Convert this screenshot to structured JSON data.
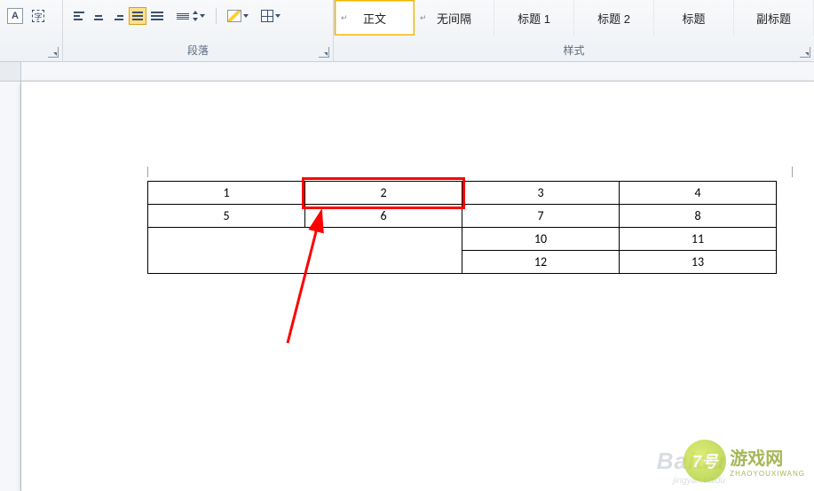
{
  "ribbon": {
    "font_group_launcher": "",
    "paragraph_label": "段落",
    "styles_label": "样式"
  },
  "styles": {
    "items": [
      {
        "label": "正文"
      },
      {
        "label": "无间隔"
      },
      {
        "label": "标题 1"
      },
      {
        "label": "标题 2"
      },
      {
        "label": "标题"
      },
      {
        "label": "副标题"
      }
    ]
  },
  "table": {
    "rows": [
      [
        "1",
        "2",
        "3",
        "4"
      ],
      [
        "5",
        "6",
        "7",
        "8"
      ],
      [
        "",
        "",
        "10",
        "11"
      ],
      [
        "",
        "",
        "12",
        "13"
      ]
    ]
  },
  "watermark": {
    "baidu": "Baidu",
    "baidu_sub": "jingyan.baidu",
    "num": "7号",
    "site": "游戏网",
    "site_sub": "ZHAOYOUXIWANG"
  }
}
